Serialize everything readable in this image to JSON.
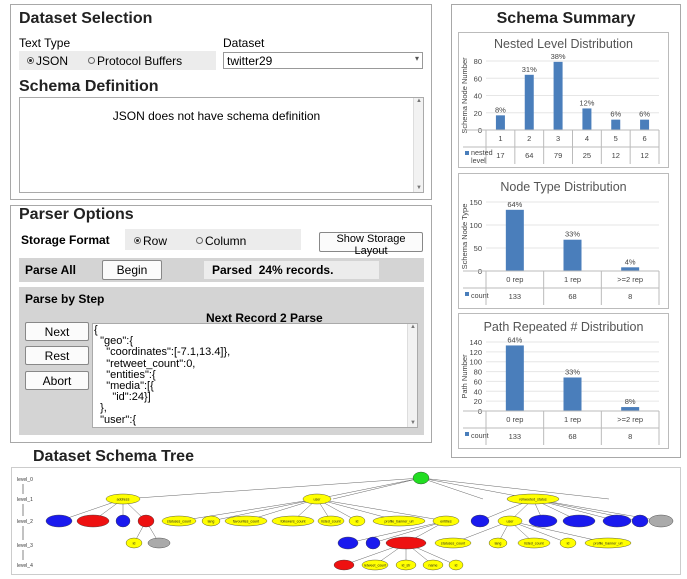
{
  "dataset_selection": {
    "title": "Dataset Selection",
    "text_type_label": "Text Type",
    "json_label": "JSON",
    "protobuf_label": "Protocol Buffers",
    "dataset_label": "Dataset",
    "dataset_value": "twitter29"
  },
  "schema_definition": {
    "title": "Schema Definition",
    "text": "JSON does not have schema definition"
  },
  "parser_options": {
    "title": "Parser Options",
    "storage_format_label": "Storage Format",
    "row_label": "Row",
    "column_label": "Column",
    "show_layout_button": "Show Storage Layout",
    "parse_all_label": "Parse All",
    "begin_button": "Begin",
    "parse_status": "Parsed  24% records.",
    "parse_by_step_label": "Parse by Step",
    "next_record_label": "Next Record 2 Parse",
    "next_button": "Next",
    "rest_button": "Rest",
    "abort_button": "Abort",
    "record_lines": [
      "{",
      "  \"geo\":{",
      "    \"coordinates\":[-7.1,13.4]},",
      "    \"retweet_count\":0,",
      "    \"entities\":{",
      "    \"media\":[{",
      "      \"id\":24}]",
      "  },",
      "  \"user\":{"
    ]
  },
  "schema_summary": {
    "title": "Schema Summary"
  },
  "chart_data": [
    {
      "type": "bar",
      "title": "Nested Level Distribution",
      "ylabel": "Schema Node Number",
      "ylim": [
        0,
        80
      ],
      "yticks": [
        0,
        20,
        40,
        60,
        80
      ],
      "categories": [
        "1",
        "2",
        "3",
        "4",
        "5",
        "6"
      ],
      "series": [
        {
          "name": "nested level",
          "values": [
            17,
            64,
            79,
            25,
            12,
            12
          ]
        }
      ],
      "data_labels": [
        "8%",
        "31%",
        "38%",
        "12%",
        "6%",
        "6%"
      ],
      "color": "#4a7ebb"
    },
    {
      "type": "bar",
      "title": "Node Type Distribution",
      "ylabel": "Schema Node Type",
      "ylim": [
        0,
        150
      ],
      "yticks": [
        0,
        50,
        100,
        150
      ],
      "categories": [
        "0 rep",
        "1 rep",
        ">=2 rep"
      ],
      "series": [
        {
          "name": "count",
          "values": [
            133,
            68,
            8
          ]
        }
      ],
      "data_labels": [
        "64%",
        "33%",
        "4%"
      ],
      "color": "#4a7ebb"
    },
    {
      "type": "bar",
      "title": "Path Repeated # Distribution",
      "ylabel": "Path Number",
      "ylim": [
        0,
        140
      ],
      "yticks": [
        0,
        20,
        40,
        60,
        80,
        100,
        120,
        140
      ],
      "categories": [
        "0 rep",
        "1 rep",
        ">=2 rep"
      ],
      "series": [
        {
          "name": "count",
          "values": [
            133,
            68,
            8
          ]
        }
      ],
      "data_labels": [
        "64%",
        "33%",
        "8%"
      ],
      "color": "#4a7ebb"
    }
  ],
  "schema_tree": {
    "title": "Dataset Schema Tree",
    "level_labels": [
      "level_0",
      "level_1",
      "level_2",
      "level_3",
      "level_4"
    ],
    "colors": {
      "root": "#22dd22",
      "object": "#ffff00",
      "array": "#1a1aee",
      "repeated": "#ee1111",
      "other": "#aaaaaa"
    },
    "level1_labels": [
      "address",
      "user",
      "retweeted_status"
    ],
    "level2_labels": [
      "statuses_count",
      "lang",
      "favourites_count",
      "followers_count",
      "listed_count",
      "id",
      "profile_banner_url",
      "entities",
      "user"
    ],
    "level3_labels": [
      "id",
      "statuses_count",
      "lang",
      "listed_count",
      "id",
      "profile_banner_url"
    ],
    "level4_labels": [
      "retweet_count",
      "id_str",
      "name",
      "id"
    ]
  }
}
